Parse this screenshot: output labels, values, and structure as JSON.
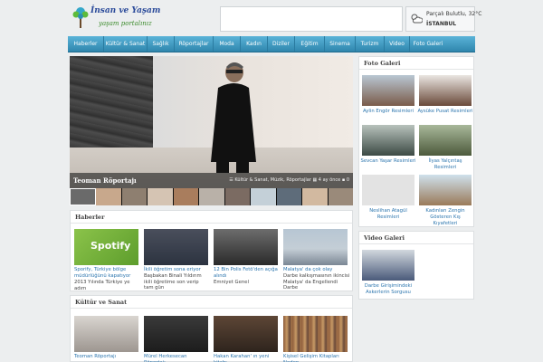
{
  "header": {
    "logo_title": "İnsan ve Yaşam",
    "logo_subtitle": "yaşam portalınız",
    "weather": {
      "condition": "Parçalı Bulutlu, 32°C",
      "city": "İSTANBUL"
    }
  },
  "nav": {
    "items": [
      "Haberler",
      "Kültür & Sanat",
      "Sağlık",
      "Röportajlar",
      "Moda",
      "Kadın",
      "Diziler",
      "Eğitim",
      "Sinema",
      "Turizm",
      "Video",
      "Foto Galeri"
    ]
  },
  "hero": {
    "title": "Teoman Röportajı",
    "categories": "Kültür & Sanat, Müzik, Röportajlar",
    "time": "4 ay önce",
    "comments": "0"
  },
  "haberler": {
    "heading": "Haberler",
    "cards": [
      {
        "title": "Sporify, Türkiye bölge müdürlüğünü kapatıyor",
        "desc": "2013 Yılında Türkiye ye adım"
      },
      {
        "title": "İkili öğretim sona eriyor",
        "desc": "Başbakan Binali Yıldırım ikili öğretime son verip tam gün"
      },
      {
        "title": "12 Bin Polis Fetö'den açığa alındı",
        "desc": "Emniyet Genel"
      },
      {
        "title": "Malatya' da çok olay",
        "desc": "Darbe kalkışmasının ikincisi Malatya' da Engellendi Darbe"
      }
    ]
  },
  "kultur": {
    "heading": "Kültür ve Sanat",
    "cards": [
      {
        "title": "Teoman Röportajı"
      },
      {
        "title": "Mürel Herkesecan Röportajı"
      },
      {
        "title": "Hakan Karahan' ın yeni kitabı"
      },
      {
        "title": "Kişisel Gelişim Kitapları Neden"
      }
    ]
  },
  "foto_galeri": {
    "heading": "Foto Galeri",
    "items": [
      {
        "label": "Aylin Engör Resimleri"
      },
      {
        "label": "Aysüke Pusat Resimleri"
      },
      {
        "label": "Sevcan Yaşar Resimleri"
      },
      {
        "label": "İlyas Yalçıntaş Resimleri"
      },
      {
        "label": "Neslihan Atagül Resimleri"
      },
      {
        "label": "Kadınları Zengin Gösteren Kış Kıyafetleri"
      }
    ]
  },
  "video_galeri": {
    "heading": "Video Galeri",
    "items": [
      {
        "label": "Darbe Girişimindeki Askerlerin Sorgusu"
      }
    ]
  }
}
